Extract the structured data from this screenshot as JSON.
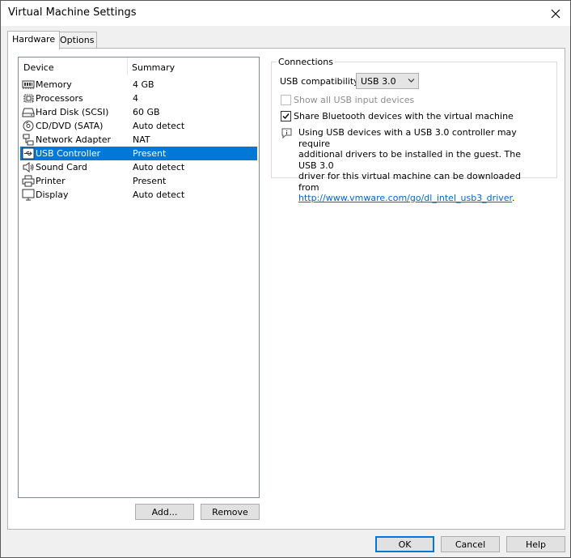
{
  "window": {
    "title": "Virtual Machine Settings"
  },
  "tabs": [
    {
      "label": "Hardware",
      "active": true
    },
    {
      "label": "Options",
      "active": false
    }
  ],
  "device_list": {
    "headers": {
      "device": "Device",
      "summary": "Summary"
    },
    "rows": [
      {
        "icon": "memory-icon",
        "name": "Memory",
        "summary": "4 GB"
      },
      {
        "icon": "processor-icon",
        "name": "Processors",
        "summary": "4"
      },
      {
        "icon": "hard-disk-icon",
        "name": "Hard Disk (SCSI)",
        "summary": "60 GB"
      },
      {
        "icon": "cd-dvd-icon",
        "name": "CD/DVD (SATA)",
        "summary": "Auto detect"
      },
      {
        "icon": "network-adapter-icon",
        "name": "Network Adapter",
        "summary": "NAT"
      },
      {
        "icon": "usb-icon",
        "name": "USB Controller",
        "summary": "Present",
        "selected": true
      },
      {
        "icon": "sound-card-icon",
        "name": "Sound Card",
        "summary": "Auto detect"
      },
      {
        "icon": "printer-icon",
        "name": "Printer",
        "summary": "Present"
      },
      {
        "icon": "display-icon",
        "name": "Display",
        "summary": "Auto detect"
      }
    ]
  },
  "buttons": {
    "add": "Add...",
    "remove": "Remove",
    "ok": "OK",
    "cancel": "Cancel",
    "help": "Help"
  },
  "connections": {
    "title": "Connections",
    "usb_compat_label": "USB compatibility:",
    "usb_compat_value": "USB 3.0",
    "show_all_usb": {
      "label": "Show all USB input devices",
      "checked": false,
      "enabled": false
    },
    "share_bluetooth": {
      "label": "Share Bluetooth devices with the virtual machine",
      "checked": true,
      "enabled": true
    },
    "info_lines": [
      "Using USB devices with a USB 3.0 controller may require",
      "additional drivers to be installed in the guest. The USB 3.0",
      "driver for this virtual machine can be downloaded from"
    ],
    "info_link": "http://www.vmware.com/go/dl_intel_usb3_driver",
    "info_link_suffix": "."
  },
  "colors": {
    "selection": "#0078d7",
    "link": "#0066cc",
    "ok_border": "#0078d7"
  }
}
